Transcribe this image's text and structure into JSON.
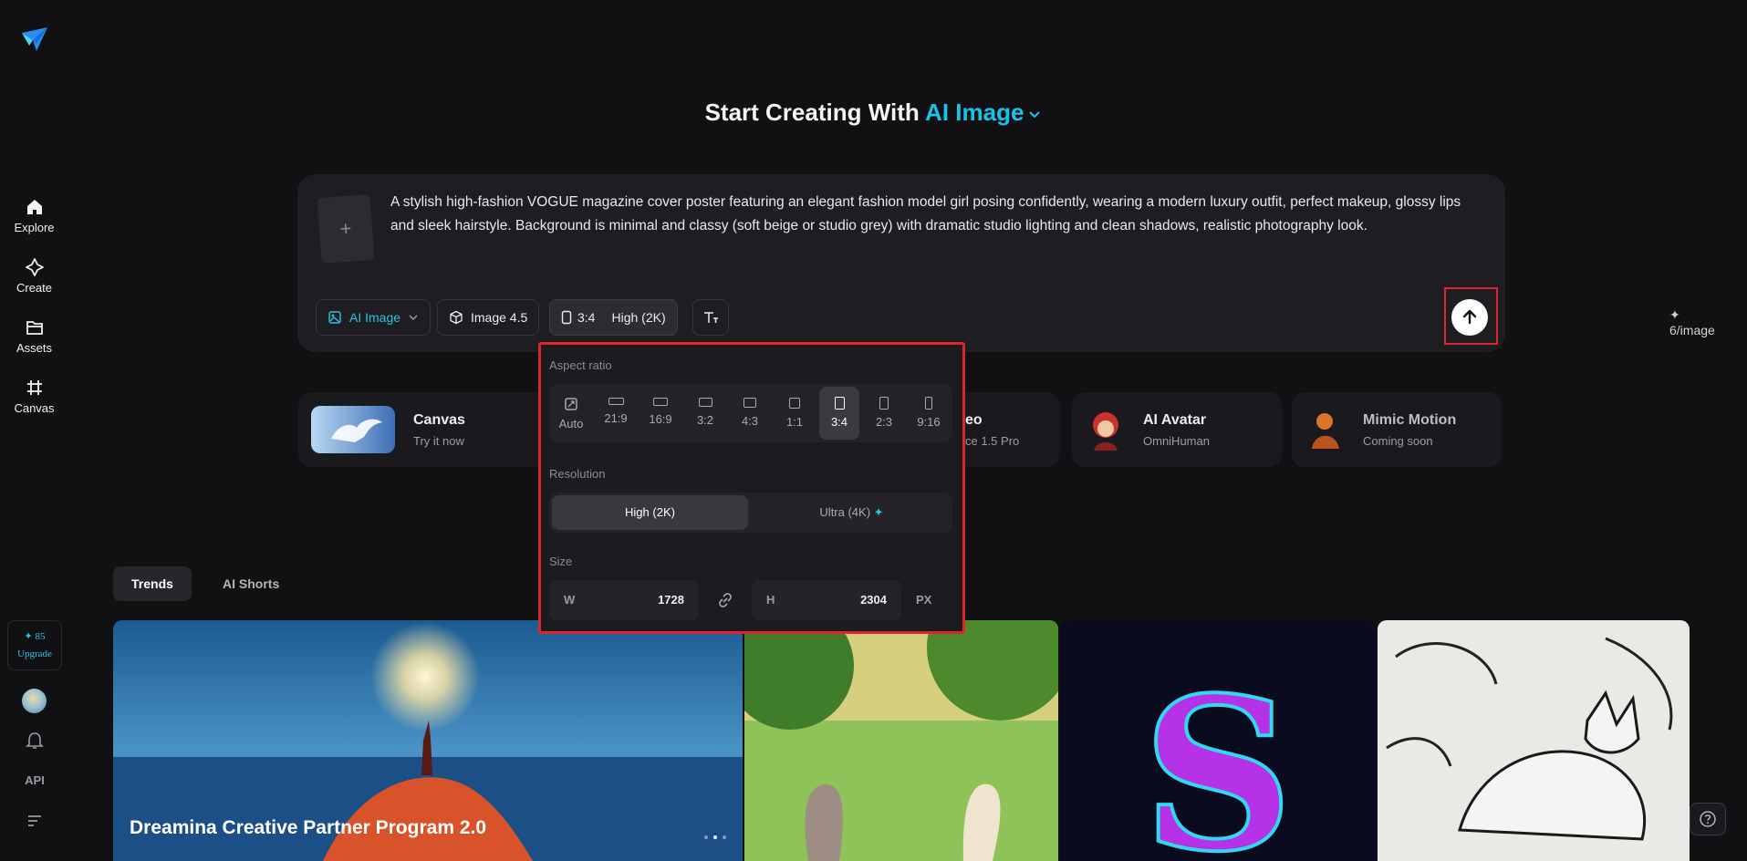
{
  "sidebar": {
    "nav": [
      {
        "label": "Explore",
        "icon": "home-icon"
      },
      {
        "label": "Create",
        "icon": "sparkle-icon"
      },
      {
        "label": "Assets",
        "icon": "folder-icon"
      },
      {
        "label": "Canvas",
        "icon": "canvas-icon"
      }
    ],
    "credits": "✦ 85",
    "upgrade": "Upgrade",
    "api": "API"
  },
  "hero": {
    "title_prefix": "Start Creating With",
    "title_accent": "AI Image"
  },
  "prompt": {
    "text": "A stylish high-fashion VOGUE magazine cover poster featuring an elegant fashion model girl posing confidently, wearing a modern luxury outfit, perfect makeup, glossy lips and sleek hairstyle. Background is minimal and classy (soft beige or studio grey) with dramatic studio lighting and clean shadows, realistic photography look.",
    "upload_symbol": "+"
  },
  "toolbar": {
    "mode": "AI Image",
    "model": "Image 4.5",
    "ratio": "3:4",
    "quality": "High (2K)",
    "cost": "✦ 6/image"
  },
  "features": [
    {
      "title": "Canvas",
      "subtitle": "Try it now"
    },
    {
      "title": "eo",
      "subtitle": "ce 1.5 Pro"
    },
    {
      "title": "AI Avatar",
      "subtitle": "OmniHuman"
    },
    {
      "title": "Mimic Motion",
      "subtitle": "Coming soon"
    }
  ],
  "popup": {
    "aspect_label": "Aspect ratio",
    "ratios": [
      "Auto",
      "21:9",
      "16:9",
      "3:2",
      "4:3",
      "1:1",
      "3:4",
      "2:3",
      "9:16"
    ],
    "selected_ratio": "3:4",
    "resolution_label": "Resolution",
    "resolutions": [
      "High (2K)",
      "Ultra (4K)"
    ],
    "selected_resolution": "High (2K)",
    "size_label": "Size",
    "width_key": "W",
    "width": "1728",
    "height_key": "H",
    "height": "2304",
    "unit": "PX"
  },
  "tabs": [
    "Trends",
    "AI Shorts"
  ],
  "gallery": {
    "banner_title": "Dreamina Creative Partner Program 2.0"
  },
  "colors": {
    "background": "#111113",
    "accent": "#18c4e6",
    "highlight_border": "#e0242a"
  }
}
